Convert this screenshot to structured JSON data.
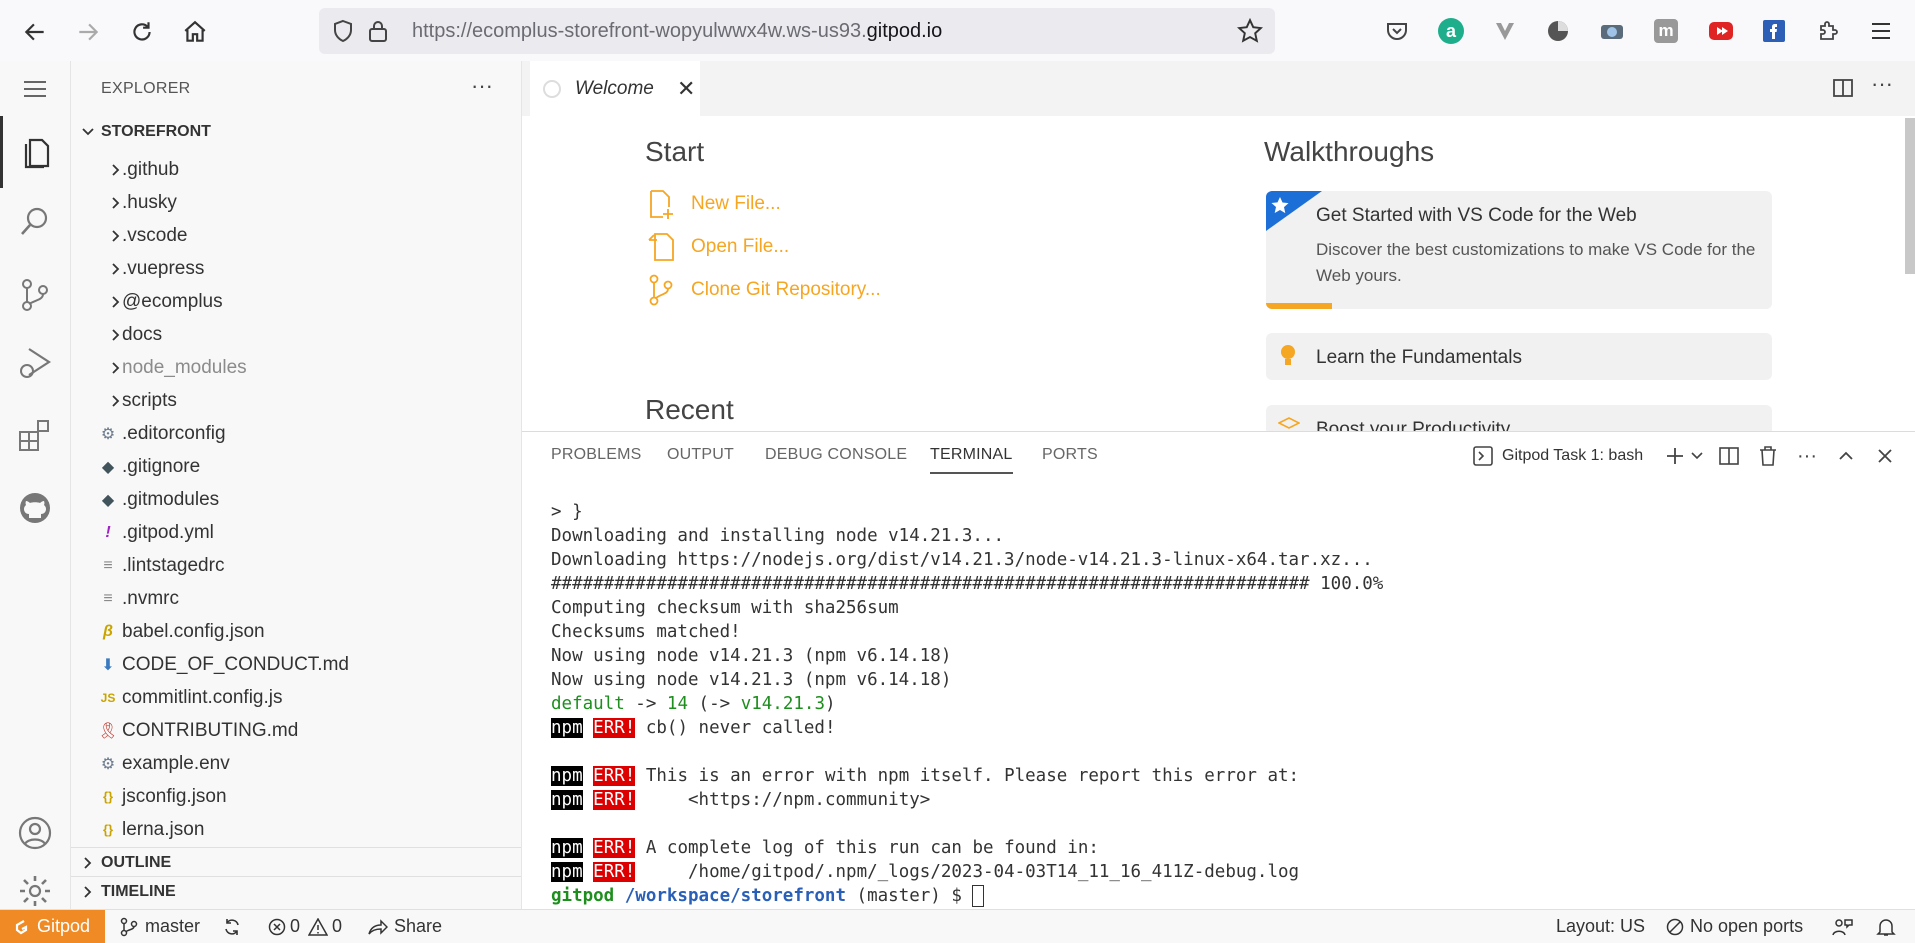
{
  "browser": {
    "url_prefix": "https://ecomplus-storefront-wopyulwwx4w.ws-us93.",
    "url_host": "gitpod.io",
    "ext_a_letter": "a",
    "ext_m_letter": "m"
  },
  "explorer": {
    "title": "EXPLORER",
    "more": "···",
    "root_label": "STOREFRONT",
    "items": [
      {
        "label": ".github",
        "icon": "chevron-right"
      },
      {
        "label": ".husky",
        "icon": "chevron-right"
      },
      {
        "label": ".vscode",
        "icon": "chevron-right"
      },
      {
        "label": ".vuepress",
        "icon": "chevron-right"
      },
      {
        "label": "@ecomplus",
        "icon": "chevron-right"
      },
      {
        "label": "docs",
        "icon": "chevron-right"
      },
      {
        "label": "node_modules",
        "icon": "chevron-right"
      },
      {
        "label": "scripts",
        "icon": "chevron-right"
      },
      {
        "label": ".editorconfig",
        "icon": "gear",
        "glyph": "⚙"
      },
      {
        "label": ".gitignore",
        "icon": "git-diamond",
        "glyph": "◆"
      },
      {
        "label": ".gitmodules",
        "icon": "git-diamond",
        "glyph": "◆"
      },
      {
        "label": ".gitpod.yml",
        "icon": "exclamation",
        "glyph": "!"
      },
      {
        "label": ".lintstagedrc",
        "icon": "lines",
        "glyph": "≡"
      },
      {
        "label": ".nvmrc",
        "icon": "lines",
        "glyph": "≡"
      },
      {
        "label": "babel.config.json",
        "icon": "babel",
        "glyph": "β"
      },
      {
        "label": "CODE_OF_CONDUCT.md",
        "icon": "down-arrow",
        "glyph": "⬇"
      },
      {
        "label": "commitlint.config.js",
        "icon": "js",
        "glyph": "JS"
      },
      {
        "label": "CONTRIBUTING.md",
        "icon": "ribbon",
        "glyph": "🎗"
      },
      {
        "label": "example.env",
        "icon": "gear",
        "glyph": "⚙"
      },
      {
        "label": "jsconfig.json",
        "icon": "braces",
        "glyph": "{}"
      },
      {
        "label": "lerna.json",
        "icon": "braces",
        "glyph": "{}"
      }
    ],
    "outline_label": "OUTLINE",
    "timeline_label": "TIMELINE"
  },
  "editor": {
    "tab_label": "Welcome",
    "tab_close": "✕",
    "start_heading": "Start",
    "start_links": [
      "New File...",
      "Open File...",
      "Clone Git Repository..."
    ],
    "recent_heading": "Recent",
    "walkthroughs_heading": "Walkthroughs",
    "card1_title": "Get Started with VS Code for the Web",
    "card1_desc": "Discover the best customizations to make VS Code for the Web yours.",
    "card1_progress": 0.13,
    "card2_title": "Learn the Fundamentals",
    "card3_title": "Boost your Productivity"
  },
  "panel": {
    "tabs": [
      "PROBLEMS",
      "OUTPUT",
      "DEBUG CONSOLE",
      "TERMINAL",
      "PORTS"
    ],
    "terminal_name": "Gitpod Task 1: bash",
    "lines": {
      "l1": "> }",
      "l2": "Downloading and installing node v14.21.3...",
      "l3": "Downloading https://nodejs.org/dist/v14.21.3/node-v14.21.3-linux-x64.tar.xz...",
      "l4": "######################################################################## 100.0%",
      "l5": "Computing checksum with sha256sum",
      "l6": "Checksums matched!",
      "l7": "Now using node v14.21.3 (npm v6.14.18)",
      "l8": "Now using node v14.21.3 (npm v6.14.18)",
      "def_a": "default",
      "def_b": " -> ",
      "def_c": "14",
      "def_d": " (-> ",
      "def_e": "v14.21.3",
      "def_f": ")",
      "npm": "npm",
      "err": "ERR!",
      "e1": " cb() never called!",
      "e2": " This is an error with npm itself. Please report this error at:",
      "e3": "     <https://npm.community>",
      "e4": " A complete log of this run can be found in:",
      "e5": "     /home/gitpod/.npm/_logs/2023-04-03T14_11_16_411Z-debug.log",
      "p_user": "gitpod",
      "p_path": " /workspace/storefront",
      "p_rest": " (master) $ "
    }
  },
  "status": {
    "gitpod": "Gitpod",
    "branch": "master",
    "errors": "0",
    "warnings": "0",
    "share": "Share",
    "layout": "Layout: US",
    "ports": "No open ports"
  },
  "colors": {
    "accent_orange": "#f08a24",
    "link_orange": "#f5a623",
    "terminal_green": "#1e8f1e",
    "err_red": "#dd0000"
  }
}
